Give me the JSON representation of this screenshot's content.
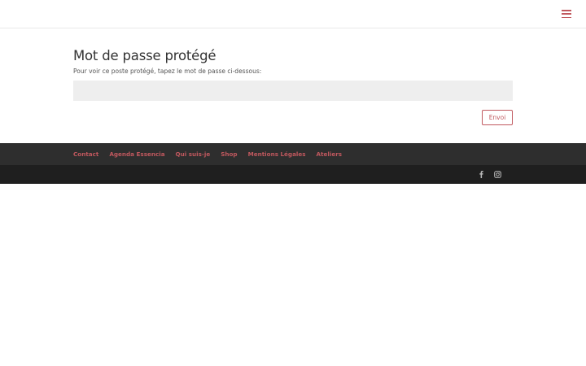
{
  "header": {
    "menu_icon": "hamburger-menu-icon"
  },
  "main": {
    "title": "Mot de passe protégé",
    "intro": "Pour voir ce poste protégé, tapez le mot de passe ci-dessous:",
    "password_value": "",
    "submit_label": "Envoi"
  },
  "footer": {
    "links": [
      "Contact",
      "Agenda Essencia",
      "Qui suis-je",
      "Shop",
      "Mentions Légales",
      "Ateliers"
    ],
    "social_icons": [
      "facebook-icon",
      "instagram-icon"
    ]
  },
  "colors": {
    "accent": "#c0585e",
    "footer_nav_bg": "#2e2e2e",
    "footer_bottom_bg": "#1f1f1f",
    "input_bg": "#eeeeee"
  }
}
